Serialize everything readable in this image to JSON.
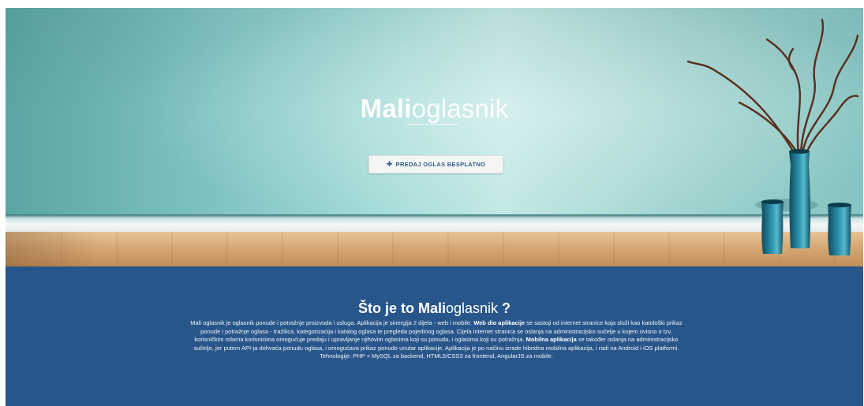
{
  "hero": {
    "title_bold": "Mali",
    "title_light": "oglasnik",
    "cta": {
      "icon": "plus-icon",
      "label": "PREDAJ OGLAS BESPLATNO"
    }
  },
  "about": {
    "heading_prefix": "Što je to ",
    "heading_bold": "Mali",
    "heading_light": "oglasnik",
    "heading_suffix": " ?",
    "paragraph": {
      "p1": "Mali oglasnik je oglasnik ponude i potražnje proizvoda i usluga. Aplikacija je sinergija 2 dijela - web i mobile. ",
      "b1": "Web dio aplikacije",
      "p2": " se sastoji od internet stranice koja služi kao katološki prikaz ponude i potražnje oglasa - tražilica, kategorizacija i katalog oglasa te pregleda pojedinog oglasa. Cijela internet stranica se oslanja na administracijsko sučelje u kojem ovisno o tzv. korisničkim rolama korisnicima omogućuje predaju i upravljanje njihovim oglasima koji su ponuda, i oglasima koji su potražnja. ",
      "b2": "Mobilna aplikacija",
      "p3": " se također oslanja na administracijsko sučelje, jer putem API-ja dohvaća ponudu oglasa, i omogućava prikaz ponude unutar aplikacije. Aplikacija je po načinu izrade hibridna mobilna aplikacija, i radi na Android i iOS platformi. Tehnologije: PHP + MySQL za backend, HTML5/CSS3 za frontend, AngularJS za mobile."
    }
  },
  "colors": {
    "about_background": "#28568a",
    "cta_text": "#2d5a88",
    "wall": "#a5dcd9",
    "vase": "#1e7c95"
  }
}
